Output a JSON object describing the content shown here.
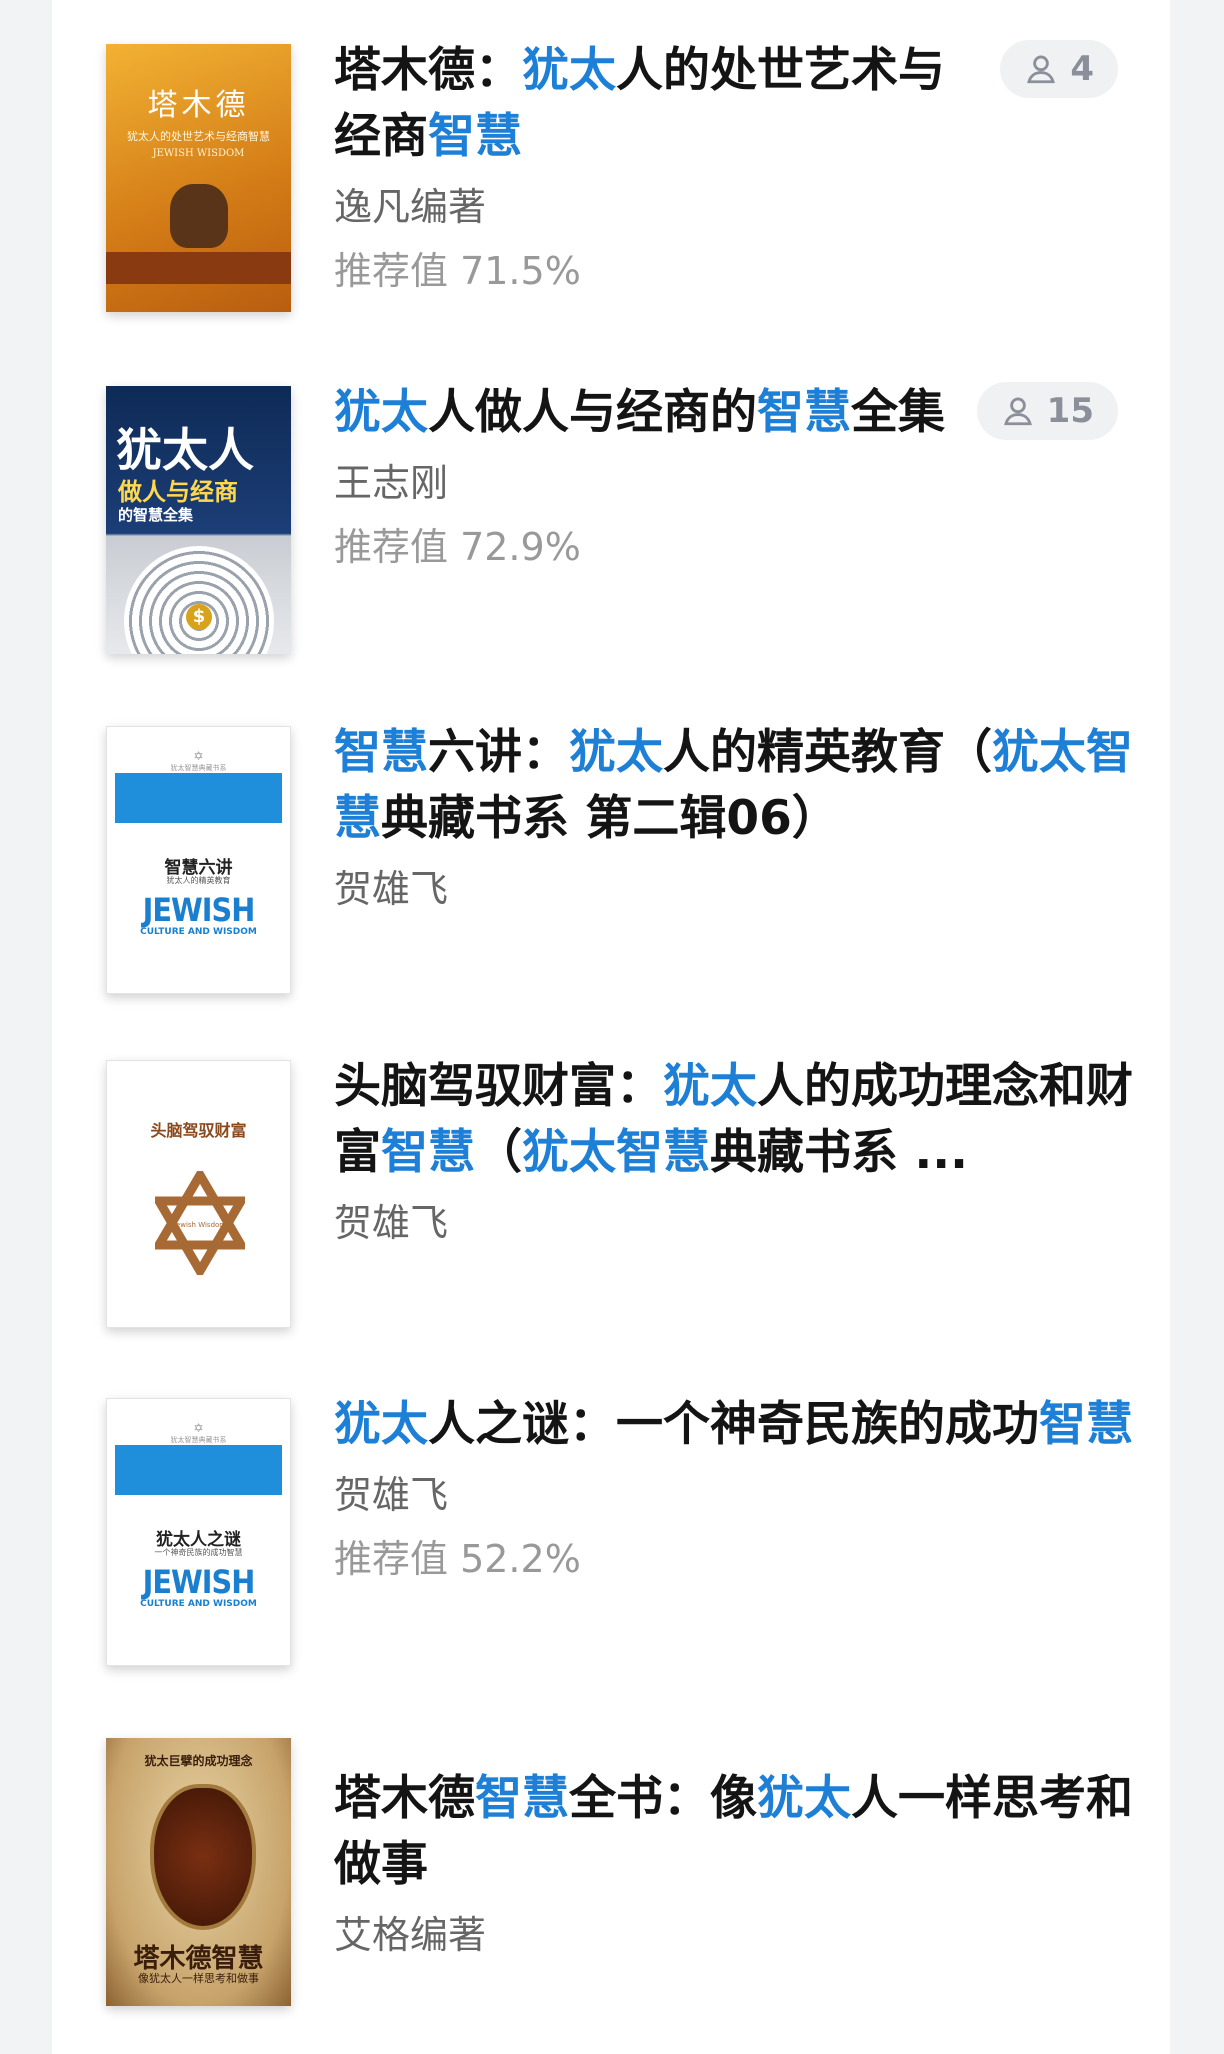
{
  "books": [
    {
      "title_segments": [
        {
          "t": "塔木德：",
          "hl": false
        },
        {
          "t": "犹太",
          "hl": true
        },
        {
          "t": "人的处世艺术与经商",
          "hl": false
        },
        {
          "t": "智慧",
          "hl": true
        }
      ],
      "author": "逸凡编著",
      "score": "推荐值 71.5%",
      "readers": "4",
      "cover": {
        "title": "塔木德",
        "sub": "犹太人的处世艺术与经商智慧",
        "en": "JEWISH WISDOM"
      }
    },
    {
      "title_segments": [
        {
          "t": "犹太",
          "hl": true
        },
        {
          "t": "人做人与经商的",
          "hl": false
        },
        {
          "t": "智慧",
          "hl": true
        },
        {
          "t": "全集",
          "hl": false
        }
      ],
      "author": "王志刚",
      "score": "推荐值 72.9%",
      "readers": "15",
      "cover": {
        "title": "犹太人",
        "sub": "做人与经商",
        "sub2": "的智慧全集"
      }
    },
    {
      "title_segments": [
        {
          "t": "智慧",
          "hl": true
        },
        {
          "t": "六讲：",
          "hl": false
        },
        {
          "t": "犹太",
          "hl": true
        },
        {
          "t": "人的精英教育（",
          "hl": false
        },
        {
          "t": "犹太智慧",
          "hl": true
        },
        {
          "t": "典藏书系 第二辑06）",
          "hl": false
        }
      ],
      "author": "贺雄飞",
      "cover": {
        "series": "犹太智慧典藏书系",
        "title": "智慧六讲",
        "sub": "犹太人的精英教育",
        "en": "JEWISH",
        "en2": "CULTURE AND WISDOM"
      }
    },
    {
      "title_segments": [
        {
          "t": "头脑驾驭财富：",
          "hl": false
        },
        {
          "t": "犹太",
          "hl": true
        },
        {
          "t": "人的成功理念和财富",
          "hl": false
        },
        {
          "t": "智慧",
          "hl": true
        },
        {
          "t": "（",
          "hl": false
        },
        {
          "t": "犹太智慧",
          "hl": true
        },
        {
          "t": "典藏书系 ...",
          "hl": false
        }
      ],
      "author": "贺雄飞",
      "cover": {
        "title": "头脑驾驭财富",
        "star_text": "Jewish Wisdom"
      }
    },
    {
      "title_segments": [
        {
          "t": "犹太",
          "hl": true
        },
        {
          "t": "人之谜：一个神奇民族的成功",
          "hl": false
        },
        {
          "t": "智慧",
          "hl": true
        }
      ],
      "author": "贺雄飞",
      "score": "推荐值 52.2%",
      "cover": {
        "series": "犹太智慧典藏书系",
        "title": "犹太人之谜",
        "sub": "一个神奇民族的成功智慧",
        "en": "JEWISH",
        "en2": "CULTURE AND WISDOM"
      }
    },
    {
      "title_segments": [
        {
          "t": "塔木德",
          "hl": false
        },
        {
          "t": "智慧",
          "hl": true
        },
        {
          "t": "全书：像",
          "hl": false
        },
        {
          "t": "犹太",
          "hl": true
        },
        {
          "t": "人一样思考和做事",
          "hl": false
        }
      ],
      "author": "艾格编著",
      "cover": {
        "top": "犹太巨擘的成功理念",
        "title": "塔木德智慧",
        "sub": "像犹太人一样思考和做事"
      }
    }
  ],
  "colors": {
    "highlight": "#1e7fd6",
    "title": "#141414",
    "author": "#666666",
    "score": "#999999"
  },
  "icons": {
    "readers": "user-icon"
  }
}
